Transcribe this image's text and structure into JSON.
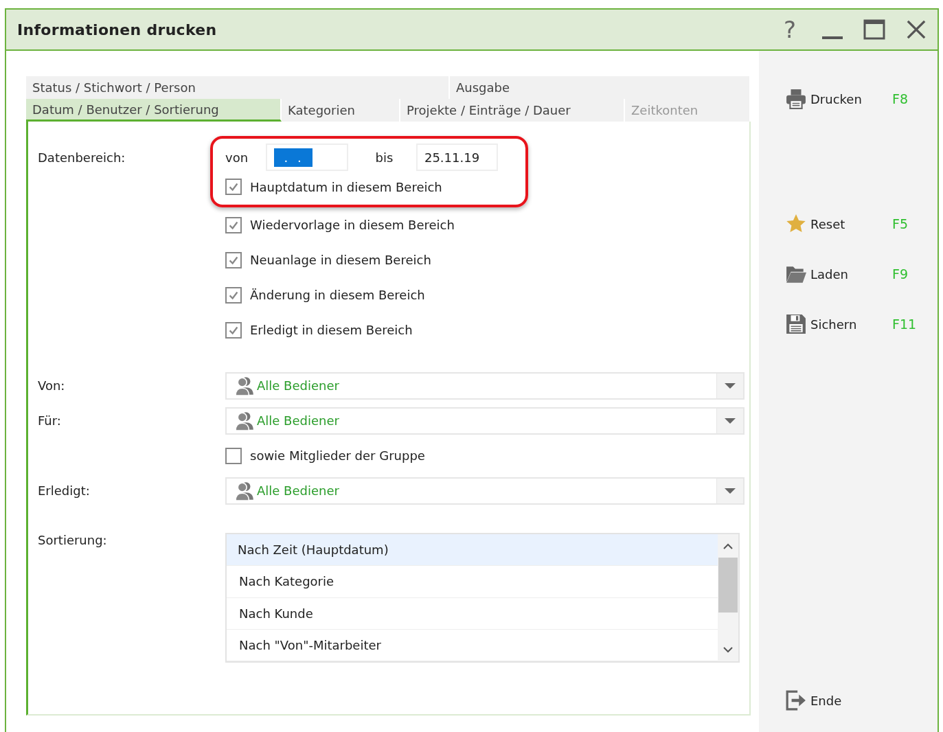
{
  "window": {
    "title": "Informationen drucken",
    "help": "?"
  },
  "tabs": [
    [
      {
        "label": "Status / Stichwort / Person",
        "selected": false,
        "disabled": false
      },
      {
        "label": "Ausgabe",
        "selected": false,
        "disabled": false
      }
    ],
    [
      {
        "label": "Datum / Benutzer / Sortierung",
        "selected": true,
        "disabled": false
      },
      {
        "label": "Kategorien",
        "selected": false,
        "disabled": false
      },
      {
        "label": "Projekte / Einträge / Dauer",
        "selected": false,
        "disabled": false
      },
      {
        "label": "Zeitkonten",
        "selected": false,
        "disabled": true
      }
    ]
  ],
  "date_range": {
    "label": "Datenbereich:",
    "from_label": "von",
    "from_value": ". .",
    "from_value_selected": true,
    "to_label": "bis",
    "to_value": "25.11.19",
    "highlighted": true,
    "checkboxes": [
      {
        "label": "Hauptdatum in diesem Bereich",
        "checked": true
      },
      {
        "label": "Wiedervorlage in diesem Bereich",
        "checked": true
      },
      {
        "label": "Neuanlage in diesem Bereich",
        "checked": true
      },
      {
        "label": "Änderung in diesem Bereich",
        "checked": true
      },
      {
        "label": "Erledigt in diesem Bereich",
        "checked": true
      }
    ]
  },
  "fields": [
    {
      "kind": "dropdown",
      "label": "Von:",
      "value": "Alle Bediener"
    },
    {
      "kind": "dropdown",
      "label": "Für:",
      "value": "Alle Bediener"
    },
    {
      "kind": "checkbox",
      "label": "sowie Mitglieder der Gruppe",
      "checked": false
    },
    {
      "kind": "dropdown",
      "label": "Erledigt:",
      "value": "Alle Bediener"
    }
  ],
  "sorting": {
    "label": "Sortierung:",
    "options": [
      {
        "label": "Nach Zeit (Hauptdatum)",
        "selected": true
      },
      {
        "label": "Nach Kategorie",
        "selected": false
      },
      {
        "label": "Nach Kunde",
        "selected": false
      },
      {
        "label": "Nach \"Von\"-Mitarbeiter",
        "selected": false
      }
    ]
  },
  "actions": {
    "top": [
      {
        "kind": "printer",
        "label": "Drucken",
        "shortcut": "F8"
      }
    ],
    "middle": [
      {
        "kind": "star",
        "label": "Reset",
        "shortcut": "F5"
      },
      {
        "kind": "folder",
        "label": "Laden",
        "shortcut": "F9"
      },
      {
        "kind": "floppy",
        "label": "Sichern",
        "shortcut": "F11"
      }
    ],
    "bottom": [
      {
        "kind": "exit",
        "label": "Ende"
      }
    ]
  }
}
